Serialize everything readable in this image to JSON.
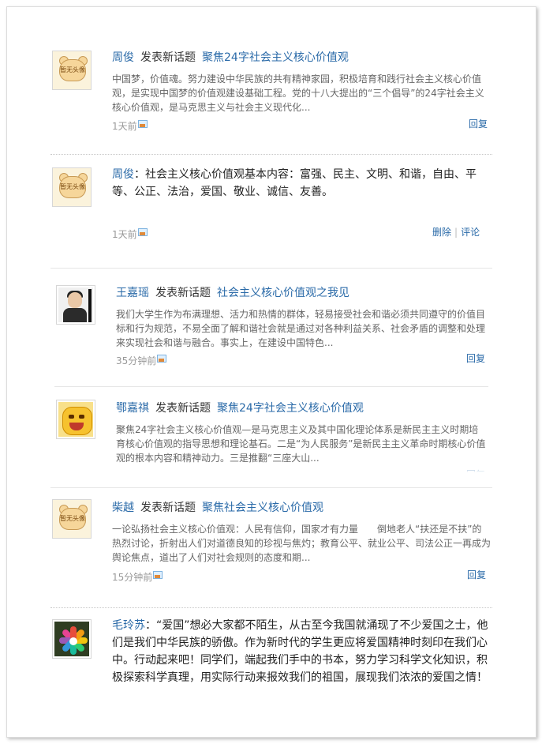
{
  "feed": [
    {
      "user": "周俊",
      "verb": "发表新话题",
      "topic": "聚焦24字社会主义核心价值观",
      "summary": "中国梦，价值魂。努力建设中华民族的共有精神家园，积极培育和践行社会主义核心价值观，是实现中国梦的价值观建设基础工程。党的十八大提出的“三个倡导”的24字社会主义核心价值观，是马克思主义与社会主义现代化...",
      "time": "1天前",
      "action": "回复",
      "avatar_text": "暂无头像"
    },
    {
      "user": "周俊",
      "content": "社会主义核心价值观基本内容：富强、民主、文明、和谐，自由、平等、公正、法治，爱国、敬业、诚信、友善。",
      "time": "1天前",
      "actions": [
        "删除",
        "评论"
      ],
      "avatar_text": "暂无头像"
    },
    {
      "user": "王嘉瑶",
      "verb": "发表新话题",
      "topic": "社会主义核心价值观之我见",
      "summary": "我们大学生作为布满理想、活力和热情的群体，轻易接受社会和谐必须共同遵守的价值目标和行为规范，不易全面了解和谐社会就是通过对各种利益关系、社会矛盾的调整和处理来实现社会和谐与融合。事实上，在建设中国特色...",
      "time": "35分钟前",
      "action": "回复"
    },
    {
      "user": "鄂嘉祺",
      "verb": "发表新话题",
      "topic": "聚焦24字社会主义核心价值观",
      "summary": "聚焦24字社会主义核心价值观—是马克思主义及其中国化理论体系是新民主主义时期培育核心价值观的指导思想和理论基石。二是“为人民服务”是新民主主义革命时期核心价值观的根本内容和精神动力。三是推翻“三座大山...",
      "time": "",
      "action": "回复"
    },
    {
      "user": "柴越",
      "verb": "发表新话题",
      "topic": "聚焦社会主义核心价值观",
      "summary": "一论弘扬社会主义核心价值观：人民有信仰，国家才有力量　　倒地老人“扶还是不扶”的热烈讨论，折射出人们对道德良知的珍视与焦灼；教育公平、就业公平、司法公正一再成为舆论焦点，道出了人们对社会规则的态度和期...",
      "time": "15分钟前",
      "action": "回复",
      "avatar_text": "暂无头像"
    },
    {
      "user": "毛玲苏",
      "content": "“爱国”想必大家都不陌生，从古至今我国就涌现了不少爱国之士，他们是我们中华民族的骄傲。作为新时代的学生更应将爱国精神时刻印在我们心中。行动起来吧！同学们，端起我们手中的书本，努力学习科学文化知识，积极探索科学真理，用实际行动来报效我们的祖国，展现我们浓浓的爱国之情！"
    }
  ],
  "colors": {
    "link": "#2a6aa8",
    "text": "#222222",
    "muted": "#999999",
    "summary": "#666666"
  }
}
